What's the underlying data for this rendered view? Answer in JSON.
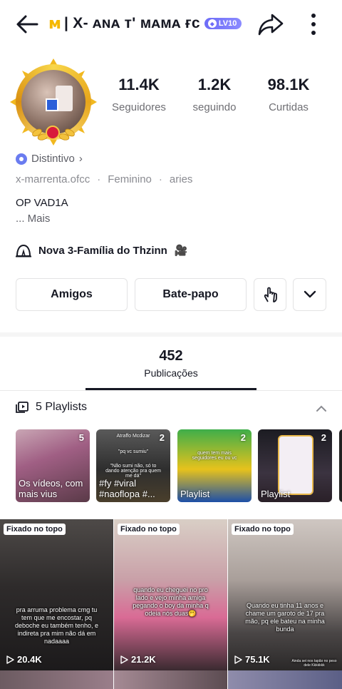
{
  "header": {
    "title": "| X- ᴀɴᴀ ᴛ' ᴍᴀᴍᴀ ғᴄ",
    "crown_glyph": "ᴍ",
    "level_badge": "LV10"
  },
  "stats": [
    {
      "value": "11.4K",
      "label": "Seguidores"
    },
    {
      "value": "1.2K",
      "label": "seguindo"
    },
    {
      "value": "98.1K",
      "label": "Curtidas"
    }
  ],
  "profile": {
    "distintivo": "Distintivo",
    "distintivo_chevron": "›",
    "username": "x-marrenta.ofcc",
    "gender": "Feminino",
    "sign": "aries",
    "meta_separator": "·",
    "bio": "OP VAD1A",
    "bio_more": "... Mais",
    "family": "Nova 3-Família do Thzinn",
    "family_emoji": "🎥"
  },
  "actions": {
    "friends_label": "Amigos",
    "chat_label": "Bate-papo"
  },
  "posts": {
    "count": "452",
    "label": "Publicações"
  },
  "playlists": {
    "header": "5 Playlists",
    "items": [
      {
        "count": "5",
        "caption": "Os vídeos, com mais vius"
      },
      {
        "count": "2",
        "caption": "#fy #viral #naoflopa #...",
        "overlay_top": "\"pq vc sumiu\"",
        "overlay_mid": "\"Não sumi não, só to dando atenção pra quem me dá\"",
        "overlay_small": "Atraffo Mcdizar"
      },
      {
        "count": "2",
        "caption": "Playlist",
        "overlay_mid": "quem tem mais seguidores eu ou vc"
      },
      {
        "count": "2",
        "caption": "Playlist"
      }
    ]
  },
  "videos": [
    {
      "pinned": "Fixado no topo",
      "views": "20.4K",
      "overlay": "pra arruma problema cmg tu tem que me encostar, pq deboche eu também tenho, e indireta pra mim não dá em nadaaaa"
    },
    {
      "pinned": "Fixado no topo",
      "views": "21.2K",
      "overlay": "quando eu cheguei no pro lado e vejo minha amiga pegando o boy da minha q odeia nós duas🤭"
    },
    {
      "pinned": "Fixado no topo",
      "views": "75.1K",
      "overlay": "Quando eu tinha 11 anos e chame um garoto de 17 pra mão, pq ele bateu na minha bunda",
      "overlay_small": "Ainda sei nos tapão no peso dele Kkkkkkk"
    }
  ],
  "colors": {
    "text": "#161823",
    "muted": "#8a8b91",
    "level_badge": "#7b7bfa",
    "gold_frame": "#f5c542"
  }
}
